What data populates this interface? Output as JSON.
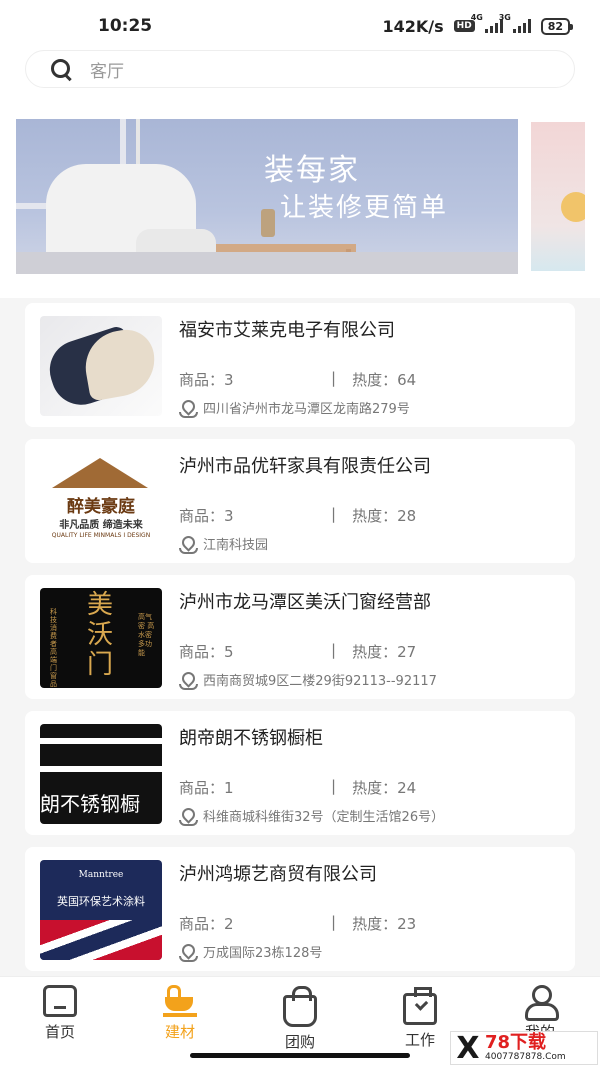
{
  "status_bar": {
    "time": "10:25",
    "speed": "142K/s",
    "hd": "HD",
    "net1": "4G",
    "net2": "3G",
    "battery": "82"
  },
  "search": {
    "placeholder": "客厅"
  },
  "banner": {
    "title": "装每家",
    "subtitle": "让装修更简单"
  },
  "stores": [
    {
      "name": "福安市艾莱克电子有限公司",
      "goods_label": "商品：3",
      "heat_label": "热度：64",
      "address": "四川省泸州市龙马潭区龙南路279号"
    },
    {
      "name": "泸州市品优轩家具有限责任公司",
      "goods_label": "商品：3",
      "heat_label": "热度：28",
      "address": "江南科技园",
      "logo_text": "醉美豪庭",
      "logo_slogan": "非凡品质 缔造未来",
      "logo_sub": "QUALITY LIFE MINMALS I DESIGN"
    },
    {
      "name": "泸州市龙马潭区美沃门窗经营部",
      "goods_label": "商品：5",
      "heat_label": "热度：27",
      "address": "西南商贸城9区二楼29街92113--92117",
      "logo_text": "美沃门",
      "logo_left": "科技消费者高端门窗品牌",
      "logo_right": "高气密 高水密 多功能"
    },
    {
      "name": "朗帝朗不锈钢橱柜",
      "goods_label": "商品：1",
      "heat_label": "热度：24",
      "address": "科维商城科维街32号（定制生活馆26号）",
      "logo_text": "朗不锈钢橱"
    },
    {
      "name": "泸州鸿塬艺商贸有限公司",
      "goods_label": "商品：2",
      "heat_label": "热度：23",
      "address": "万成国际23栋128号",
      "logo_brand": "Manntree",
      "logo_text": "英国环保艺术涂料"
    }
  ],
  "separator": "|",
  "tabs": [
    {
      "label": "首页",
      "icon": "home-icon"
    },
    {
      "label": "建材",
      "icon": "bathtub-icon",
      "active": true
    },
    {
      "label": "团购",
      "icon": "shopping-bag-icon"
    },
    {
      "label": "工作",
      "icon": "briefcase-icon"
    },
    {
      "label": "我的",
      "icon": "user-icon"
    }
  ],
  "watermark": {
    "brand": "78下载",
    "url": "4007787878.Com"
  },
  "colors": {
    "accent": "#f3a21b",
    "background": "#f5f5f5"
  }
}
